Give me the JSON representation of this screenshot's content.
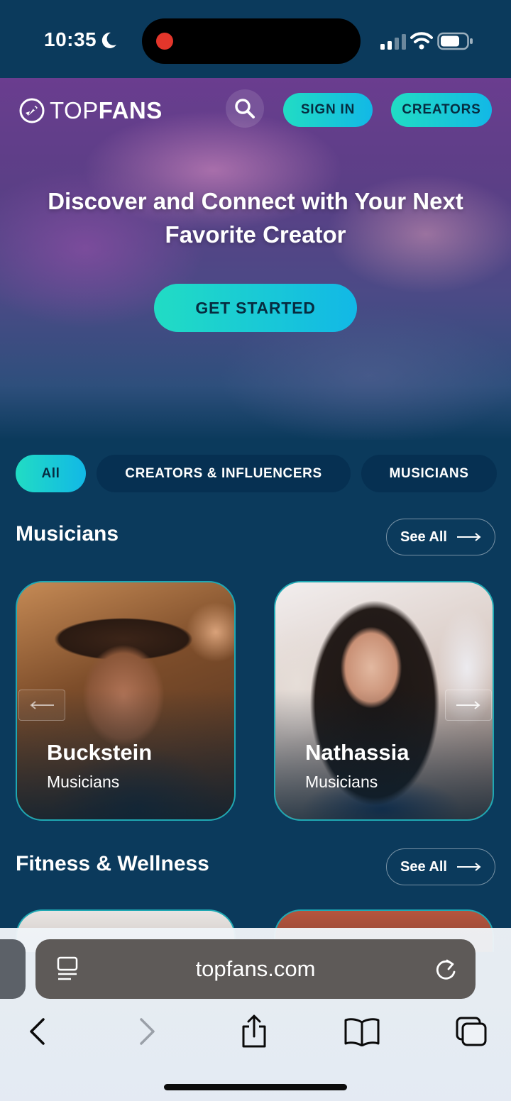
{
  "status_bar": {
    "time": "10:35"
  },
  "header": {
    "logo_regular": "TOP",
    "logo_bold": "FANS",
    "signin_label": "SIGN IN",
    "creators_label": "CREATORS"
  },
  "hero": {
    "title": "Discover and Connect with Your Next Favorite Creator",
    "cta_label": "GET STARTED"
  },
  "tabs": [
    {
      "label": "All",
      "active": true
    },
    {
      "label": "CREATORS & INFLUENCERS",
      "active": false
    },
    {
      "label": "MUSICIANS",
      "active": false
    }
  ],
  "sections": [
    {
      "title": "Musicians",
      "see_all_label": "See All",
      "cards": [
        {
          "name": "Buckstein",
          "category": "Musicians"
        },
        {
          "name": "Nathassia",
          "category": "Musicians"
        }
      ]
    },
    {
      "title": "Fitness & Wellness",
      "see_all_label": "See All"
    }
  ],
  "browser": {
    "url": "topfans.com"
  },
  "colors": {
    "accent_start": "#21dcc4",
    "accent_end": "#12b8e6",
    "background": "#0b3a5c",
    "tab_bg": "#063052"
  }
}
